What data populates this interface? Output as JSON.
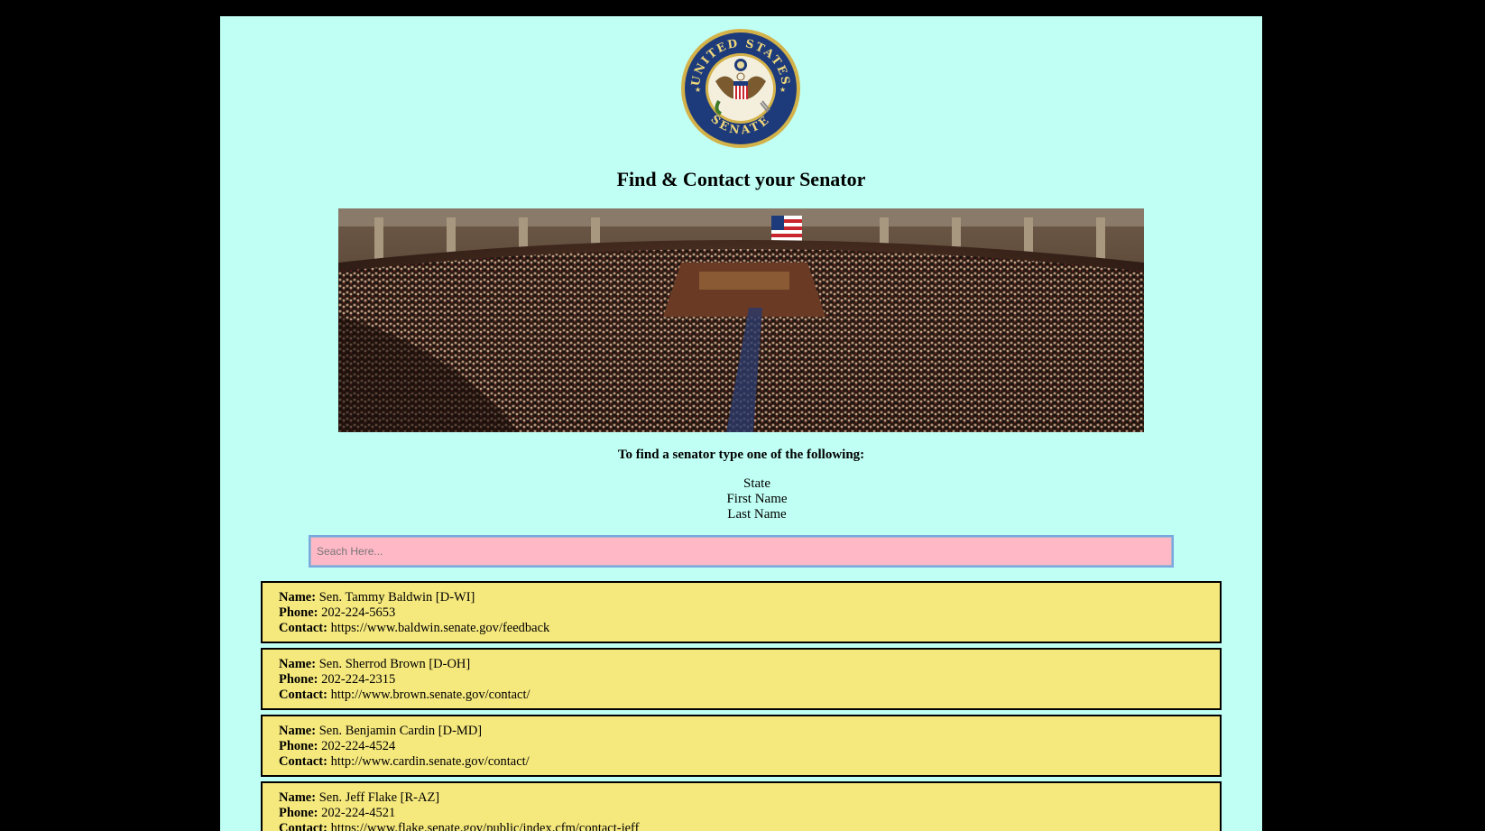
{
  "seal": {
    "top_text": "UNITED STATES",
    "bottom_text": "SENATE"
  },
  "title": "Find & Contact your Senator",
  "hero": {
    "icon": "senate-chamber-photo"
  },
  "instructions": "To find a senator type one of the following:",
  "options": [
    "State",
    "First Name",
    "Last Name"
  ],
  "search": {
    "placeholder": "Seach Here...",
    "value": ""
  },
  "labels": {
    "name": "Name:",
    "phone": "Phone:",
    "contact": "Contact:"
  },
  "senators": [
    {
      "name": "Sen. Tammy Baldwin [D-WI]",
      "phone": "202-224-5653",
      "contact": "https://www.baldwin.senate.gov/feedback"
    },
    {
      "name": "Sen. Sherrod Brown [D-OH]",
      "phone": "202-224-2315",
      "contact": "http://www.brown.senate.gov/contact/"
    },
    {
      "name": "Sen. Benjamin Cardin [D-MD]",
      "phone": "202-224-4524",
      "contact": "http://www.cardin.senate.gov/contact/"
    },
    {
      "name": "Sen. Jeff Flake [R-AZ]",
      "phone": "202-224-4521",
      "contact": "https://www.flake.senate.gov/public/index.cfm/contact-jeff"
    }
  ],
  "colors": {
    "page_bg": "#c0fff4",
    "outer_bg": "#000000",
    "card_bg": "#f5e87d",
    "search_bg": "#ffb8c6",
    "seal_blue": "#1d3b7a",
    "seal_gold": "#d4b24a"
  }
}
